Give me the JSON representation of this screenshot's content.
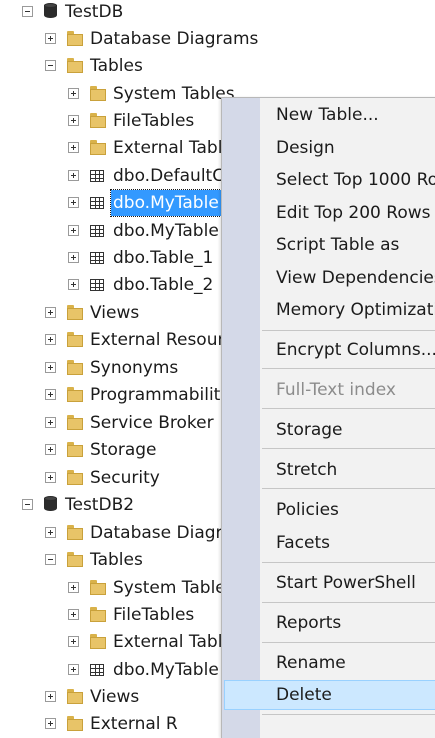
{
  "tree": {
    "testdb": "TestDB",
    "testdb_database_diagrams": "Database Diagrams",
    "testdb_tables": "Tables",
    "testdb_system_tables": "System Tables",
    "testdb_filetables": "FileTables",
    "testdb_external_tables": "External Tabl",
    "testdb_dbo_defaultc": "dbo.DefaultC",
    "testdb_dbo_mytable_selected": "dbo.MyTable",
    "testdb_dbo_mytable_2": "dbo.MyTable",
    "testdb_dbo_table_1": "dbo.Table_1",
    "testdb_dbo_table_2": "dbo.Table_2",
    "testdb_views": "Views",
    "testdb_external_resources": "External Resourc",
    "testdb_synonyms": "Synonyms",
    "testdb_programmability": "Programmability",
    "testdb_service_broker": "Service Broker",
    "testdb_storage": "Storage",
    "testdb_security": "Security",
    "testdb2": "TestDB2",
    "testdb2_database_diagrams": "Database Diagr",
    "testdb2_tables": "Tables",
    "testdb2_system_tables": "System Table",
    "testdb2_filetables": "FileTables",
    "testdb2_external_tables": "External Tabl",
    "testdb2_dbo_mytable": "dbo.MyTable",
    "testdb2_views": "Views",
    "testdb2_external_resources": "External R"
  },
  "context_menu": {
    "new_table": "New Table...",
    "design": "Design",
    "select_top_1000": "Select Top 1000 Ro",
    "edit_top_200": "Edit Top 200 Rows",
    "script_table_as": "Script Table as",
    "view_dependencies": "View Dependencies",
    "memory_optimization": "Memory Optimizati",
    "encrypt_columns": "Encrypt Columns...",
    "full_text_index": "Full-Text index",
    "storage": "Storage",
    "stretch": "Stretch",
    "policies": "Policies",
    "facets": "Facets",
    "start_powershell": "Start PowerShell",
    "reports": "Reports",
    "rename": "Rename",
    "delete": "Delete"
  },
  "colors": {
    "selection": "#3399ff",
    "menu_highlight": "#cce8ff",
    "menu_gutter": "#d4d9e8"
  }
}
